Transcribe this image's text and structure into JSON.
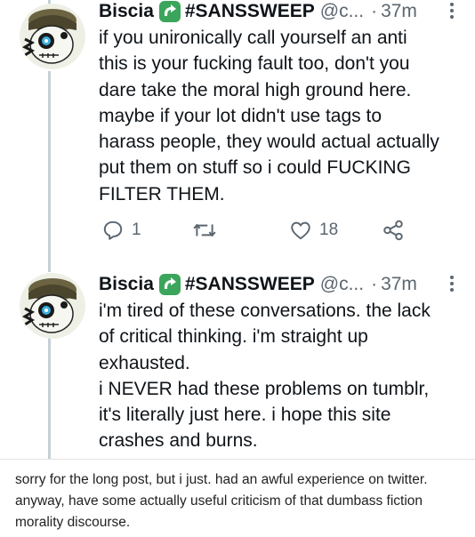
{
  "tweets": [
    {
      "display_name": "Biscia",
      "badge_icon": "recycle-arrow-icon",
      "hashtag": "#SANSSWEEP",
      "handle": "@c...",
      "dot": "·",
      "time": "37m",
      "lines": [
        "if you unironically call yourself an anti",
        "this is your fucking fault too, don't you",
        "dare take the moral high ground here.",
        "maybe if your lot didn't use tags to",
        "harass people, they would actual actually",
        "put them on stuff so i could FUCKING",
        "FILTER THEM."
      ],
      "actions": {
        "reply_count": "1",
        "retweet_count": "",
        "like_count": "18"
      }
    },
    {
      "display_name": "Biscia",
      "badge_icon": "recycle-arrow-icon",
      "hashtag": "#SANSSWEEP",
      "handle": "@c...",
      "dot": "·",
      "time": "37m",
      "lines": [
        "i'm tired of these conversations. the lack",
        "of critical thinking. i'm straight up",
        "exhausted.",
        "i NEVER had these problems on tumblr,",
        "it's literally just here. i hope this site",
        "crashes and burns."
      ]
    }
  ],
  "caption": {
    "lines": [
      "sorry for the long post, but i just. had an awful experience on twitter.",
      "anyway, have some actually useful criticism of that dumbass fiction",
      "morality discourse."
    ]
  },
  "colors": {
    "text": "#0f1419",
    "secondary": "#5b6670",
    "badge_green": "#3ba55c",
    "thread_line": "#c4cfd6"
  }
}
